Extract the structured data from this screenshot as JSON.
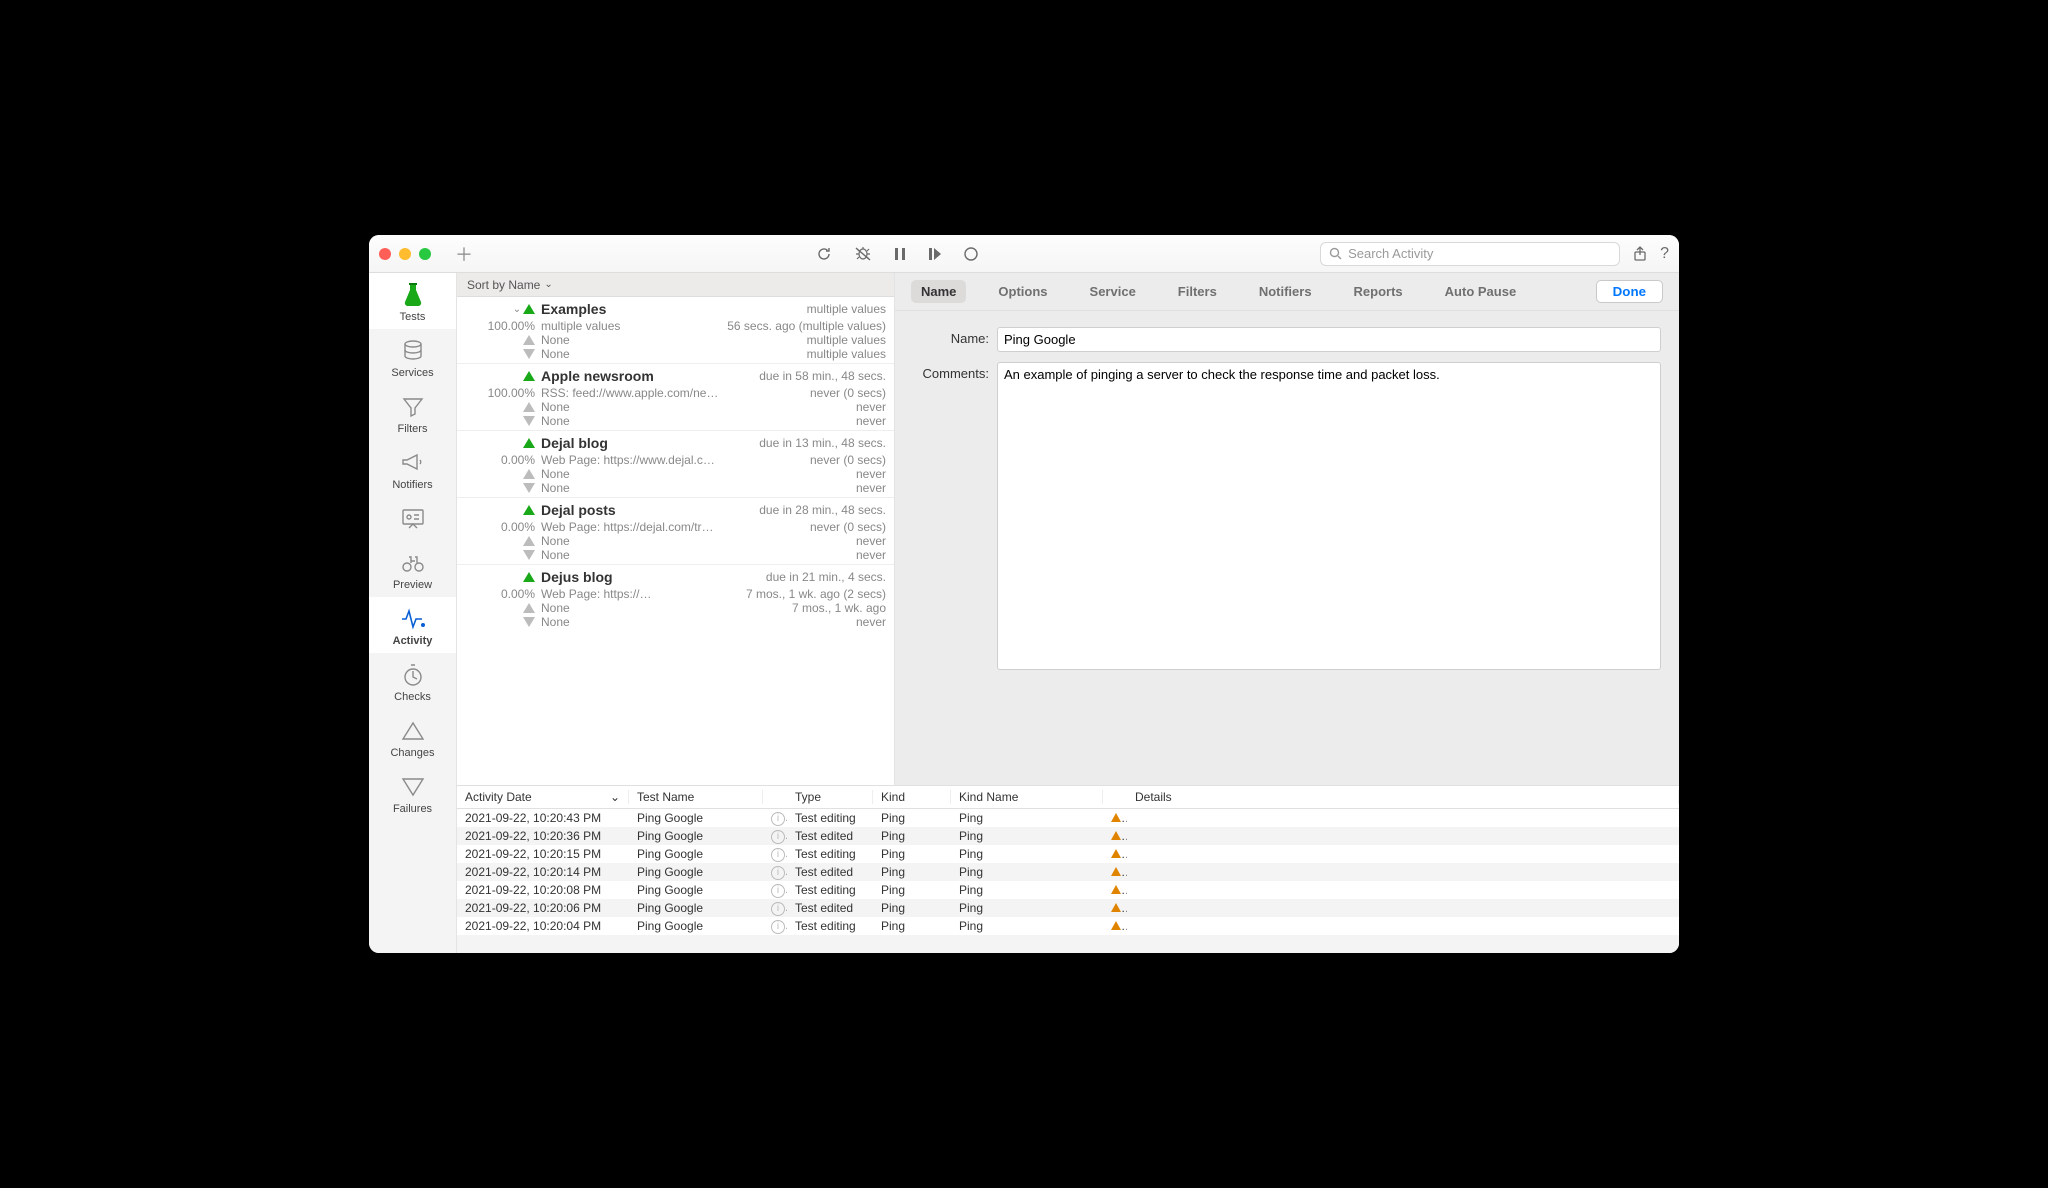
{
  "toolbar": {
    "search_placeholder": "Search Activity"
  },
  "sidebar": {
    "items": [
      {
        "label": "Tests"
      },
      {
        "label": "Services"
      },
      {
        "label": "Filters"
      },
      {
        "label": "Notifiers"
      },
      {
        "label": ""
      },
      {
        "label": "Preview"
      },
      {
        "label": "Activity"
      },
      {
        "label": "Checks"
      },
      {
        "label": "Changes"
      },
      {
        "label": "Failures"
      }
    ]
  },
  "sort_header": "Sort by Name",
  "tests": [
    {
      "name": "Examples",
      "pct": "100.00%",
      "due": "multiple values",
      "sub": "multiple values",
      "subdue": "56 secs. ago (multiple values)",
      "none1": "None",
      "none1due": "multiple values",
      "none2": "None",
      "none2due": "multiple values",
      "expandable": true
    },
    {
      "name": "Apple newsroom",
      "pct": "100.00%",
      "due": "due in 58 min., 48 secs.",
      "sub": "RSS: feed://www.apple.com/ne…",
      "subdue": "never (0 secs)",
      "none1": "None",
      "none1due": "never",
      "none2": "None",
      "none2due": "never"
    },
    {
      "name": "Dejal blog",
      "pct": "0.00%",
      "due": "due in 13 min., 48 secs.",
      "sub": "Web Page: https://www.dejal.c…",
      "subdue": "never (0 secs)",
      "none1": "None",
      "none1due": "never",
      "none2": "None",
      "none2due": "never"
    },
    {
      "name": "Dejal posts",
      "pct": "0.00%",
      "due": "due in 28 min., 48 secs.",
      "sub": "Web Page: https://dejal.com/tr…",
      "subdue": "never (0 secs)",
      "none1": "None",
      "none1due": "never",
      "none2": "None",
      "none2due": "never"
    },
    {
      "name": "Dejus blog",
      "pct": "0.00%",
      "due": "due in 21 min., 4 secs.",
      "sub": "Web Page: https://…",
      "subdue": "7 mos., 1 wk. ago (2 secs)",
      "none1": "None",
      "none1due": "7 mos., 1 wk. ago",
      "none2": "None",
      "none2due": "never"
    }
  ],
  "tabs": {
    "items": [
      "Name",
      "Options",
      "Service",
      "Filters",
      "Notifiers",
      "Reports",
      "Auto Pause"
    ],
    "done": "Done"
  },
  "form": {
    "name_label": "Name:",
    "name_value": "Ping Google",
    "comments_label": "Comments:",
    "comments_value": "An example of pinging a server to check the response time and packet loss."
  },
  "activity": {
    "columns": {
      "date": "Activity Date",
      "test": "Test Name",
      "type": "Type",
      "kind": "Kind",
      "kname": "Kind Name",
      "details": "Details"
    },
    "rows": [
      {
        "date": "2021-09-22, 10:20:43 PM",
        "test": "Ping Google",
        "type": "Test editing",
        "kind": "Ping",
        "kname": "Ping"
      },
      {
        "date": "2021-09-22, 10:20:36 PM",
        "test": "Ping Google",
        "type": "Test edited",
        "kind": "Ping",
        "kname": "Ping"
      },
      {
        "date": "2021-09-22, 10:20:15 PM",
        "test": "Ping Google",
        "type": "Test editing",
        "kind": "Ping",
        "kname": "Ping"
      },
      {
        "date": "2021-09-22, 10:20:14 PM",
        "test": "Ping Google",
        "type": "Test edited",
        "kind": "Ping",
        "kname": "Ping"
      },
      {
        "date": "2021-09-22, 10:20:08 PM",
        "test": "Ping Google",
        "type": "Test editing",
        "kind": "Ping",
        "kname": "Ping"
      },
      {
        "date": "2021-09-22, 10:20:06 PM",
        "test": "Ping Google",
        "type": "Test edited",
        "kind": "Ping",
        "kname": "Ping"
      },
      {
        "date": "2021-09-22, 10:20:04 PM",
        "test": "Ping Google",
        "type": "Test editing",
        "kind": "Ping",
        "kname": "Ping"
      }
    ]
  }
}
